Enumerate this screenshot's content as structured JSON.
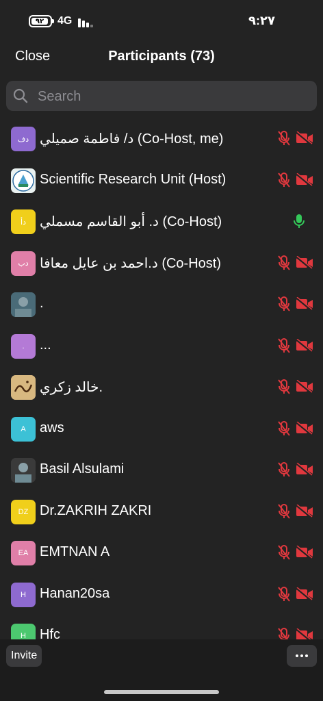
{
  "status_bar": {
    "battery": "٩٢",
    "network": "4G",
    "time": "٩:٢٧"
  },
  "nav": {
    "close_label": "Close",
    "title": "Participants (73)"
  },
  "search": {
    "placeholder": "Search"
  },
  "colors": {
    "muted_red": "#e0383e",
    "unmuted_green": "#34c759"
  },
  "participants": [
    {
      "name": "د/ فاطمة صميلي (Co-Host, me)",
      "initials": "دف",
      "avatar_color": "#8e6ad0",
      "avatar_kind": "initials",
      "mic": "muted",
      "video": "off"
    },
    {
      "name": "Scientific Research Unit (Host)",
      "initials": "",
      "avatar_color": "#e9f1f0",
      "avatar_kind": "logo",
      "mic": "muted",
      "video": "off"
    },
    {
      "name": "د. أبو القاسم مسملي (Co-Host)",
      "initials": "دأ",
      "avatar_color": "#f0cf1b",
      "avatar_kind": "initials",
      "mic": "on",
      "video": "none"
    },
    {
      "name": "د.احمد بن عايل معافا (Co-Host)",
      "initials": "دب",
      "avatar_color": "#e07fa8",
      "avatar_kind": "initials",
      "mic": "muted",
      "video": "off"
    },
    {
      "name": ".",
      "initials": "",
      "avatar_color": "#4a6b78",
      "avatar_kind": "photo",
      "mic": "muted",
      "video": "off"
    },
    {
      "name": "...",
      "initials": ".",
      "avatar_color": "#b47ad6",
      "avatar_kind": "initials",
      "mic": "muted",
      "video": "off"
    },
    {
      "name": "خالد زكري.",
      "initials": "",
      "avatar_color": "#c9a46a",
      "avatar_kind": "calligraphy",
      "mic": "muted",
      "video": "off"
    },
    {
      "name": "aws",
      "initials": "A",
      "avatar_color": "#3cc1d6",
      "avatar_kind": "initials",
      "mic": "muted",
      "video": "off"
    },
    {
      "name": "Basil Alsulami",
      "initials": "",
      "avatar_color": "#3a3a3a",
      "avatar_kind": "photo",
      "mic": "muted",
      "video": "off"
    },
    {
      "name": "Dr.ZAKRIH ZAKRI",
      "initials": "DZ",
      "avatar_color": "#f0cf1b",
      "avatar_kind": "initials",
      "mic": "muted",
      "video": "off"
    },
    {
      "name": "EMTNAN A",
      "initials": "EA",
      "avatar_color": "#e07fa8",
      "avatar_kind": "initials",
      "mic": "muted",
      "video": "off"
    },
    {
      "name": "Hanan20sa",
      "initials": "H",
      "avatar_color": "#8e6ad0",
      "avatar_kind": "initials",
      "mic": "muted",
      "video": "off"
    },
    {
      "name": "Hfc",
      "initials": "H",
      "avatar_color": "#4cc86f",
      "avatar_kind": "initials",
      "mic": "muted",
      "video": "off"
    }
  ],
  "bottom_bar": {
    "invite_label": "Invite",
    "more_icon": "ellipsis-icon"
  }
}
